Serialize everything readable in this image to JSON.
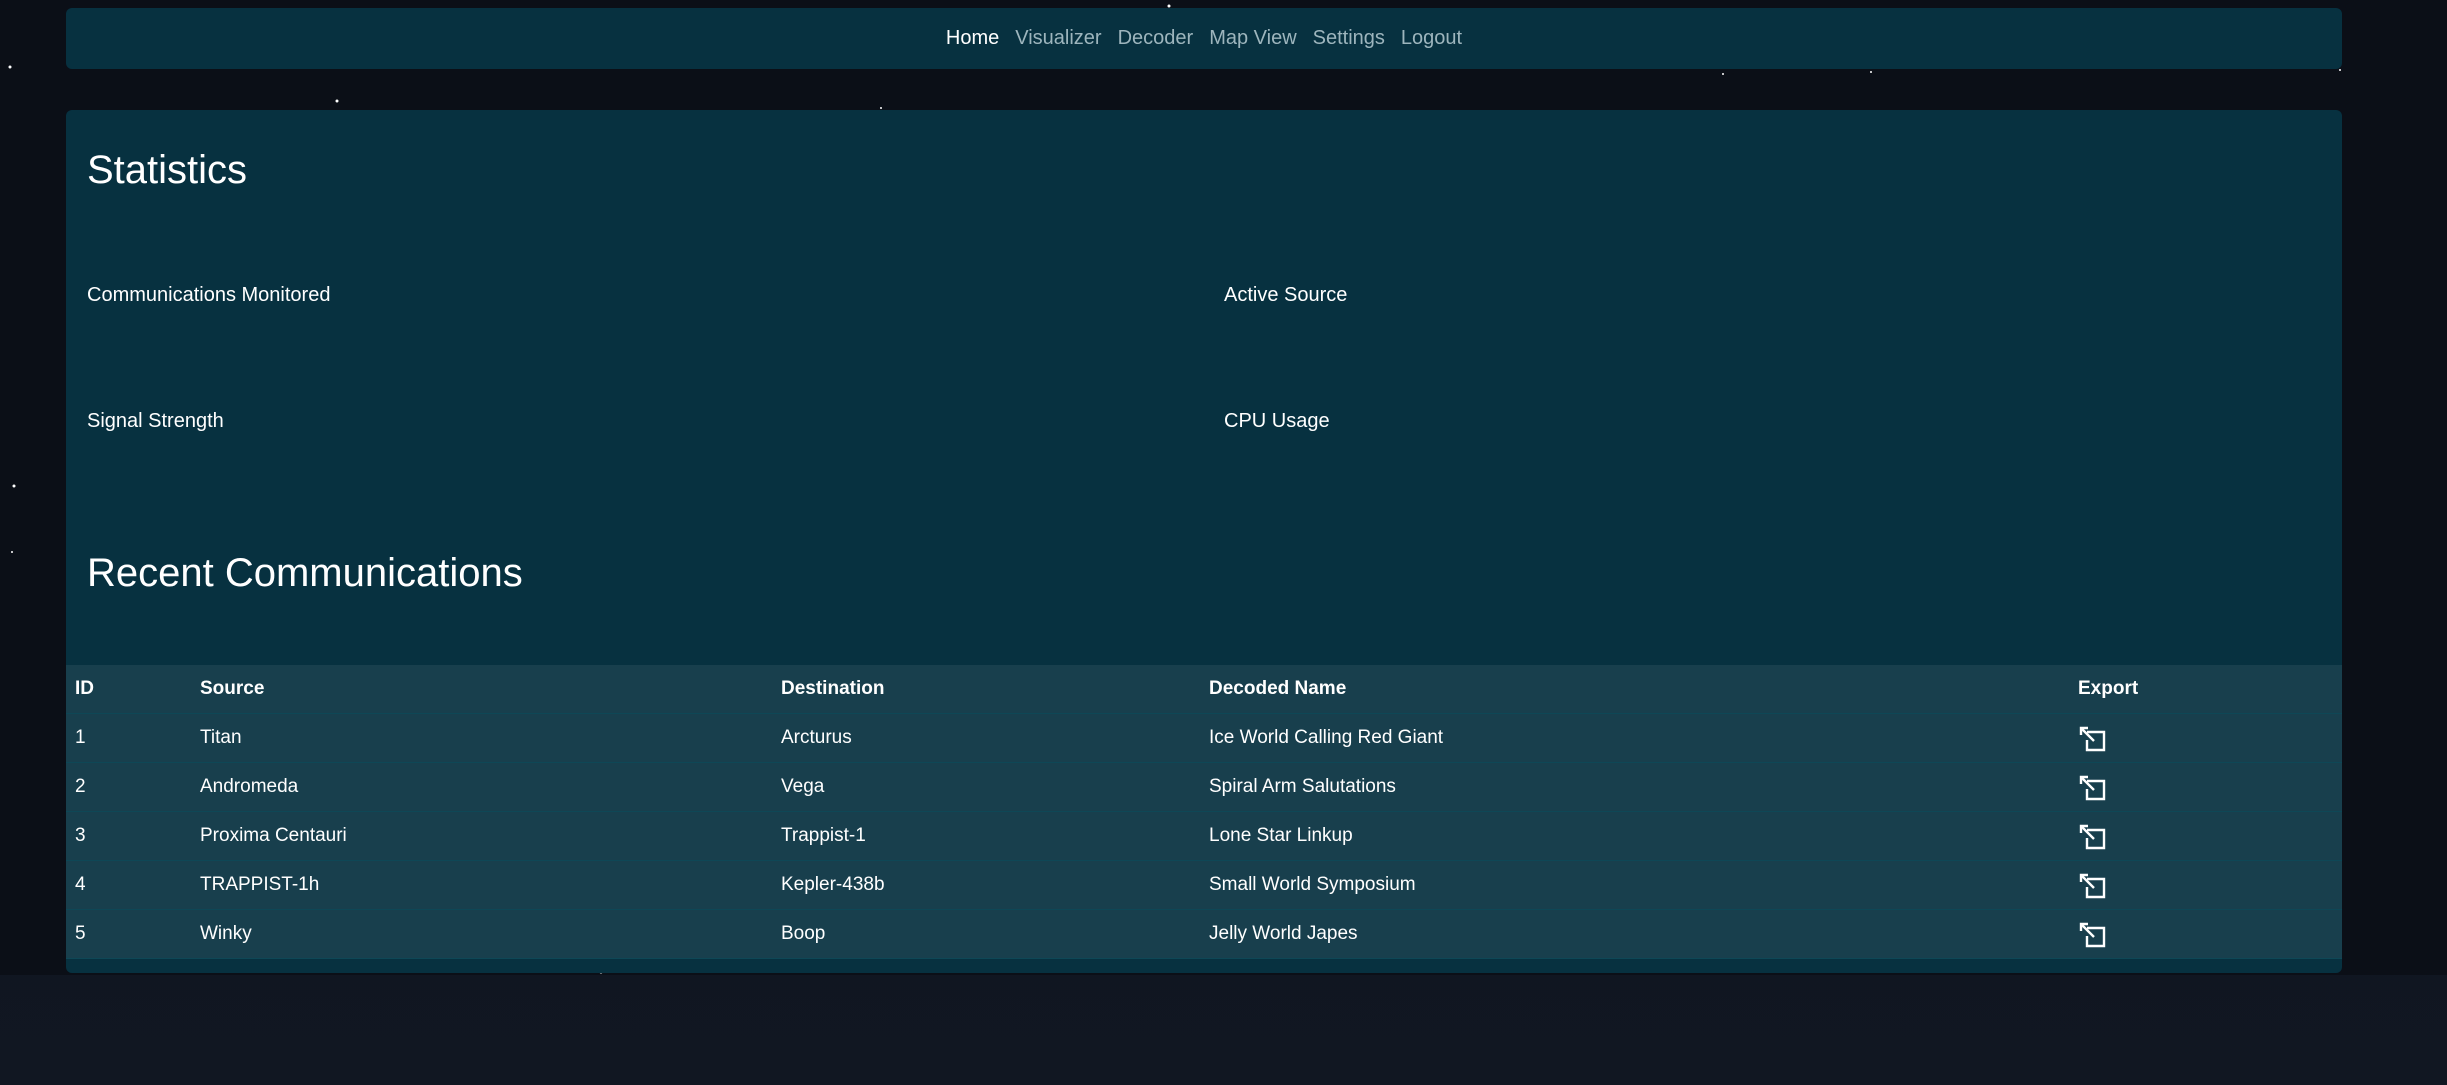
{
  "nav": {
    "items": [
      {
        "label": "Home",
        "active": true
      },
      {
        "label": "Visualizer",
        "active": false
      },
      {
        "label": "Decoder",
        "active": false
      },
      {
        "label": "Map View",
        "active": false
      },
      {
        "label": "Settings",
        "active": false
      },
      {
        "label": "Logout",
        "active": false
      }
    ]
  },
  "statistics": {
    "title": "Statistics",
    "labels": {
      "communications_monitored": "Communications Monitored",
      "active_source": "Active Source",
      "signal_strength": "Signal Strength",
      "cpu_usage": "CPU Usage"
    }
  },
  "recent": {
    "title": "Recent Communications",
    "columns": [
      "ID",
      "Source",
      "Destination",
      "Decoded Name",
      "Export"
    ],
    "rows": [
      {
        "id": "1",
        "source": "Titan",
        "destination": "Arcturus",
        "decoded_name": "Ice World Calling Red Giant",
        "export_icon": "export-icon"
      },
      {
        "id": "2",
        "source": "Andromeda",
        "destination": "Vega",
        "decoded_name": "Spiral Arm Salutations",
        "export_icon": "export-icon"
      },
      {
        "id": "3",
        "source": "Proxima Centauri",
        "destination": "Trappist-1",
        "decoded_name": "Lone Star Linkup",
        "export_icon": "export-icon"
      },
      {
        "id": "4",
        "source": "TRAPPIST-1h",
        "destination": "Kepler-438b",
        "decoded_name": "Small World Symposium",
        "export_icon": "export-icon"
      },
      {
        "id": "5",
        "source": "Winky",
        "destination": "Boop",
        "decoded_name": "Jelly World Japes",
        "export_icon": "export-icon"
      }
    ]
  },
  "colors": {
    "panel": "#073140",
    "background": "#0b0f17",
    "nav_inactive": "#9db5bd",
    "text": "#ffffff"
  }
}
